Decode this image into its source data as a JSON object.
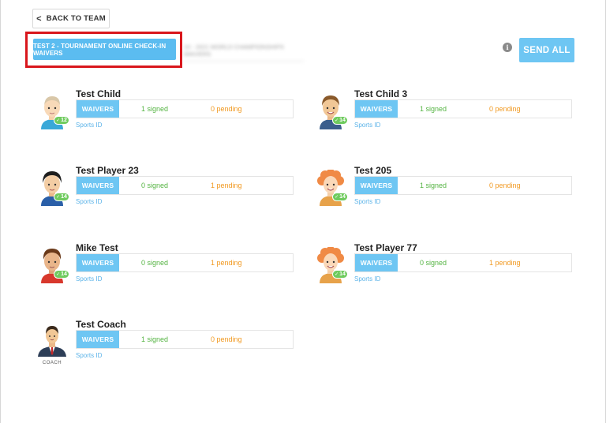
{
  "header": {
    "back_label": "BACK TO TEAM",
    "active_tab": "TEST 2 - TOURNAMENT ONLINE CHECK-IN WAIVERS",
    "blurred_tab": "10 - 2021 WORLD CHAMPIONSHIPS WAIVERS",
    "send_all_label": "SEND ALL"
  },
  "labels": {
    "waivers": "WAIVERS",
    "sports_id": "Sports ID",
    "coach": "COACH"
  },
  "players": [
    {
      "name": "Test Child",
      "signed": "1 signed",
      "pending": "0 pending",
      "badge": "12",
      "avatar": "boy-light"
    },
    {
      "name": "Test Child 3",
      "signed": "1 signed",
      "pending": "0 pending",
      "badge": "14",
      "avatar": "boy-brown"
    },
    {
      "name": "Test Player 23",
      "signed": "0 signed",
      "pending": "1 pending",
      "badge": "14",
      "avatar": "boy-dark"
    },
    {
      "name": "Test 205",
      "signed": "1 signed",
      "pending": "0 pending",
      "badge": "14",
      "avatar": "girl-curly"
    },
    {
      "name": "Mike Test",
      "signed": "0 signed",
      "pending": "1 pending",
      "badge": "14",
      "avatar": "boy-tan"
    },
    {
      "name": "Test Player 77",
      "signed": "0 signed",
      "pending": "1 pending",
      "badge": "14",
      "avatar": "girl-curly"
    },
    {
      "name": "Test Coach",
      "signed": "1 signed",
      "pending": "0 pending",
      "badge": "",
      "avatar": "coach"
    }
  ],
  "colors": {
    "accent": "#6ec6f3",
    "signed": "#55b443",
    "pending": "#f19a22",
    "badge": "#6fcb5e",
    "highlight": "#d9161c"
  }
}
